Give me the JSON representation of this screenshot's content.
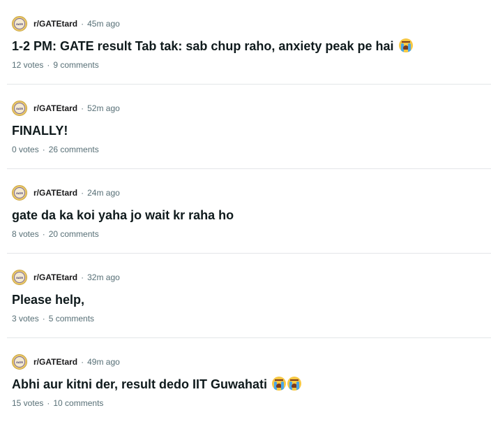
{
  "posts": [
    {
      "subreddit": "r/GATEtard",
      "time": "45m ago",
      "title": "1-2 PM: GATE result Tab tak: sab chup raho, anxiety peak pe hai",
      "emojis": [
        "loudly-crying-face-icon"
      ],
      "votes": "12 votes",
      "comments": "9 comments"
    },
    {
      "subreddit": "r/GATEtard",
      "time": "52m ago",
      "title": "FINALLY!",
      "emojis": [],
      "votes": "0 votes",
      "comments": "26 comments"
    },
    {
      "subreddit": "r/GATEtard",
      "time": "24m ago",
      "title": "gate da ka koi yaha jo wait kr raha ho",
      "emojis": [],
      "votes": "8 votes",
      "comments": "20 comments"
    },
    {
      "subreddit": "r/GATEtard",
      "time": "32m ago",
      "title": "Please help,",
      "emojis": [],
      "votes": "3 votes",
      "comments": "5 comments"
    },
    {
      "subreddit": "r/GATEtard",
      "time": "49m ago",
      "title": "Abhi aur kitni der, result dedo IIT Guwahati",
      "emojis": [
        "loudly-crying-face-icon",
        "loudly-crying-face-icon"
      ],
      "votes": "15 votes",
      "comments": "10 comments"
    }
  ],
  "avatar_text": "GATE",
  "separator": "·",
  "colors": {
    "meta_text": "#576f76",
    "title_text": "#0f1a1c",
    "divider": "#e3e6e8"
  }
}
